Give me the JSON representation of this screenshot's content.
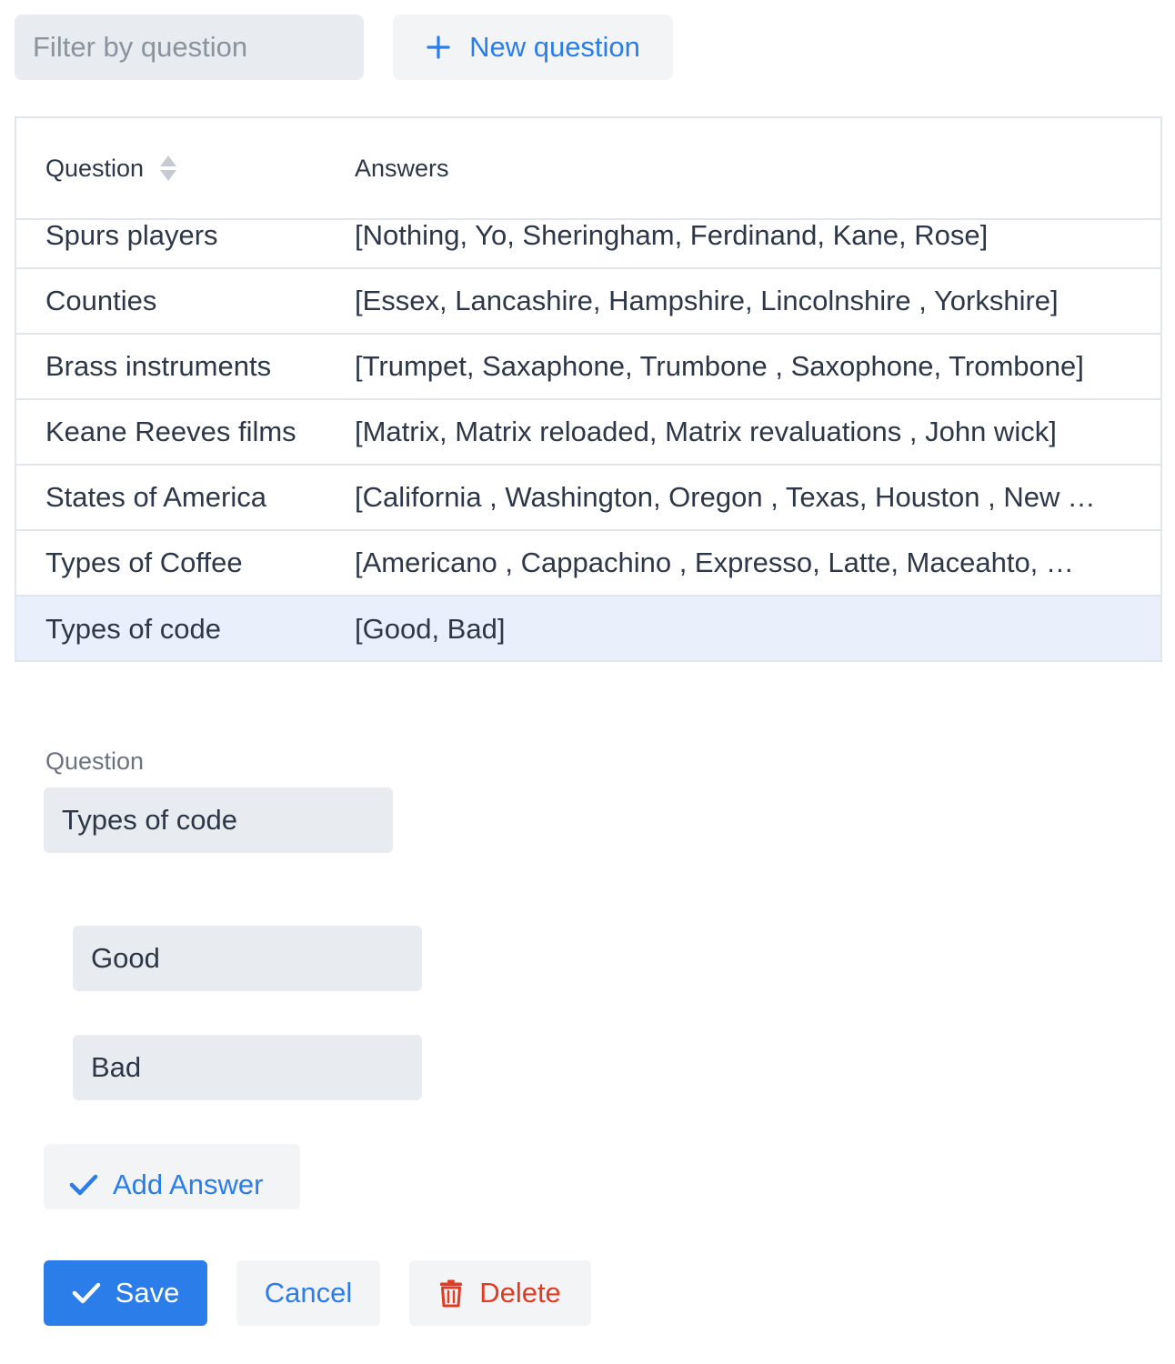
{
  "toolbar": {
    "filter_placeholder": "Filter by question",
    "filter_value": "",
    "new_question_label": "New question"
  },
  "table": {
    "columns": [
      "Question",
      "Answers"
    ],
    "sort_column": "Question",
    "rows": [
      {
        "question": "Spurs players",
        "answers": "[Nothing, Yo, Sheringham, Ferdinand, Kane, Rose]"
      },
      {
        "question": "Counties",
        "answers": "[Essex, Lancashire, Hampshire, Lincolnshire , Yorkshire]"
      },
      {
        "question": "Brass instruments",
        "answers": "[Trumpet, Saxaphone, Trumbone , Saxophone, Trombone]"
      },
      {
        "question": "Keane Reeves films",
        "answers": "[Matrix, Matrix reloaded, Matrix revaluations , John wick]"
      },
      {
        "question": "States of America",
        "answers": "[California , Washington, Oregon , Texas, Houston , New York]"
      },
      {
        "question": "Types of Coffee",
        "answers": "[Americano , Cappachino , Expresso, Latte, Maceahto, Mocha]"
      },
      {
        "question": "Types of code",
        "answers": "[Good, Bad]",
        "selected": true
      }
    ]
  },
  "form": {
    "question_label": "Question",
    "question_value": "Types of code",
    "answers": [
      "Good",
      "Bad"
    ],
    "add_answer_label": "Add Answer",
    "save_label": "Save",
    "cancel_label": "Cancel",
    "delete_label": "Delete"
  },
  "colors": {
    "accent": "#2b7de9",
    "danger": "#e03b24",
    "selected_row": "#e9f0fb",
    "field_bg": "#e8ebef"
  },
  "icons": {
    "new_question": "plus-icon",
    "sort": "sort-icon",
    "add_answer": "check-icon",
    "save": "check-icon",
    "delete": "trash-icon"
  }
}
